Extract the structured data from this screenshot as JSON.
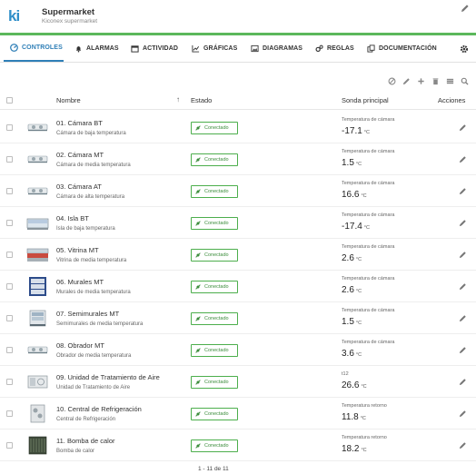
{
  "app": {
    "logo_text": "ki",
    "title": "Supermarket",
    "subtitle": "Kiconex supermarket",
    "accent": "#2f7fb7",
    "status_green": "#5cb85c"
  },
  "nav": {
    "tabs": [
      {
        "label": "CONTROLES",
        "icon": "sliders-icon",
        "active": true
      },
      {
        "label": "ALARMAS",
        "icon": "bell-icon"
      },
      {
        "label": "ACTIVIDAD",
        "icon": "calendar-icon"
      },
      {
        "label": "GRÁFICAS",
        "icon": "line-chart-icon"
      },
      {
        "label": "DIAGRAMAS",
        "icon": "image-icon"
      },
      {
        "label": "REGLAS",
        "icon": "cogs-icon"
      },
      {
        "label": "DOCUMENTACIÓN",
        "icon": "copy-icon"
      }
    ]
  },
  "table": {
    "columns": {
      "name": "Nombre",
      "status": "Estado",
      "probe": "Sonda principal",
      "actions": "Acciones"
    },
    "rows": [
      {
        "name": "01. Cámara BT",
        "desc": "Cámara de baja temperatura",
        "status": "Conectado",
        "probe_label": "Temperatura de cámara",
        "value": "-17.1",
        "unit": "°C",
        "thumb": "evaporator"
      },
      {
        "name": "02. Cámara MT",
        "desc": "Cámara de media temperatura",
        "status": "Conectado",
        "probe_label": "Temperatura de cámara",
        "value": "1.5",
        "unit": "°C",
        "thumb": "evaporator"
      },
      {
        "name": "03. Cámara AT",
        "desc": "Cámara de alta temperatura",
        "status": "Conectado",
        "probe_label": "Temperatura de cámara",
        "value": "16.6",
        "unit": "°C",
        "thumb": "evaporator"
      },
      {
        "name": "04. Isla BT",
        "desc": "Isla de baja temperatura",
        "status": "Conectado",
        "probe_label": "Temperatura de cámara",
        "value": "-17.4",
        "unit": "°C",
        "thumb": "island"
      },
      {
        "name": "05. Vitrina MT",
        "desc": "Vitrina de media temperatura",
        "status": "Conectado",
        "probe_label": "Temperatura de cámara",
        "value": "2.6",
        "unit": "°C",
        "thumb": "showcase"
      },
      {
        "name": "06. Murales MT",
        "desc": "Murales de media temperatura",
        "status": "Conectado",
        "probe_label": "Temperatura de cámara",
        "value": "2.6",
        "unit": "°C",
        "thumb": "wall"
      },
      {
        "name": "07. Semimurales MT",
        "desc": "Semimurales de media temperatura",
        "status": "Conectado",
        "probe_label": "Temperatura de cámara",
        "value": "1.5",
        "unit": "°C",
        "thumb": "semiwall"
      },
      {
        "name": "08. Obrador MT",
        "desc": "Obrador de media temperatura",
        "status": "Conectado",
        "probe_label": "Temperatura de cámara",
        "value": "3.6",
        "unit": "°C",
        "thumb": "evaporator"
      },
      {
        "name": "09. Unidad de Tratamiento de Aire",
        "desc": "Unidad de Tratamiento de Aire",
        "status": "Conectado",
        "probe_label": "t12",
        "value": "26.6",
        "unit": "°C",
        "thumb": "ahu"
      },
      {
        "name": "10. Central de Refrigeración",
        "desc": "Central de Refrigeración",
        "status": "Conectado",
        "probe_label": "Temperatura retorno",
        "value": "11.8",
        "unit": "°C",
        "thumb": "rack"
      },
      {
        "name": "11. Bomba de calor",
        "desc": "Bomba de calor",
        "status": "Conectado",
        "probe_label": "Temperatura retorno",
        "value": "18.2",
        "unit": "°C",
        "thumb": "heatpump"
      }
    ]
  },
  "pagination": "1 - 11 de 11"
}
